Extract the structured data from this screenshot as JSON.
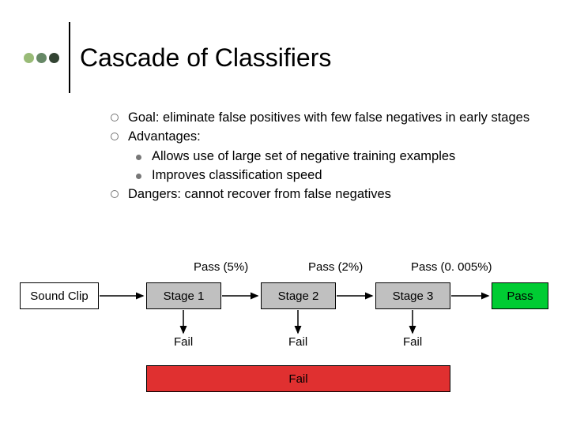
{
  "title": "Cascade of Classifiers",
  "dots": [
    "#99bb77",
    "#668866",
    "#334433"
  ],
  "bullets": {
    "goal": "Goal: eliminate false positives with few false negatives in early stages",
    "adv": "Advantages:",
    "adv1": "Allows use of large set of negative training examples",
    "adv2": "Improves classification speed",
    "dang": "Dangers: cannot recover from false negatives"
  },
  "diagram": {
    "input": "Sound Clip",
    "stage1": "Stage 1",
    "stage2": "Stage 2",
    "stage3": "Stage 3",
    "final": "Pass",
    "pass1": "Pass (5%)",
    "pass2": "Pass (2%)",
    "pass3": "Pass (0. 005%)",
    "fail": "Fail",
    "failbox": "Fail",
    "colors": {
      "input": "#ffffff",
      "stage": "#c0c0c0",
      "final": "#00cc33",
      "failbox": "#e03030"
    }
  }
}
